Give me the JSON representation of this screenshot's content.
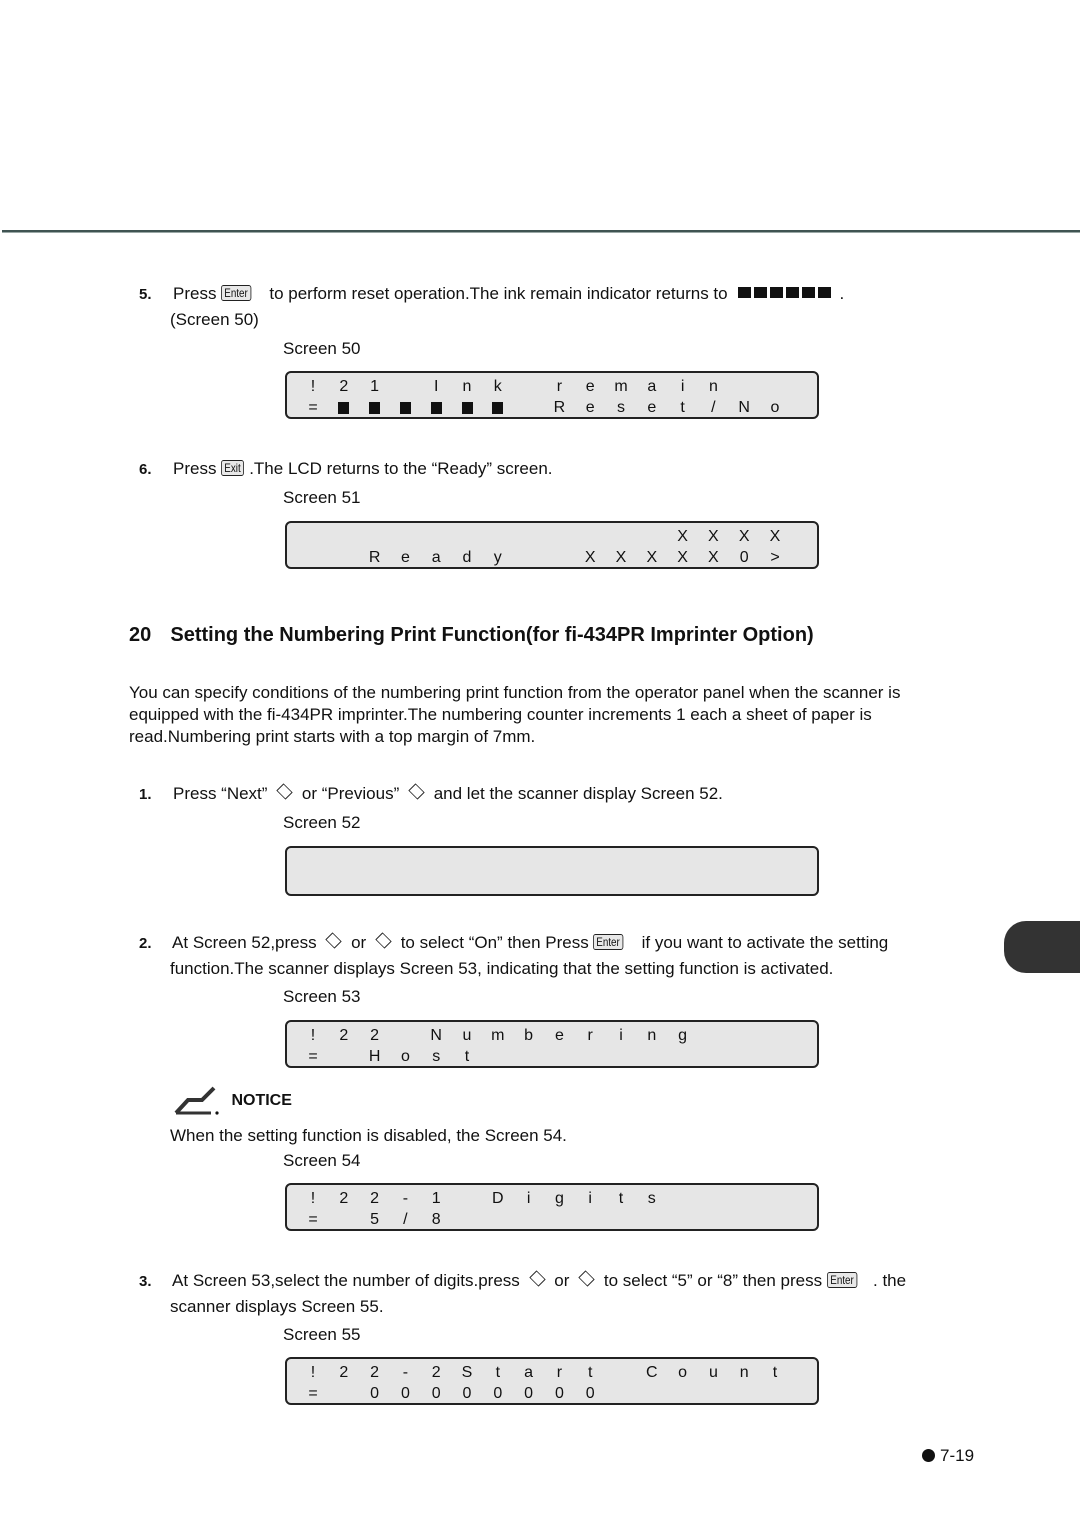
{
  "page": {
    "number": "7-19",
    "side_tab_color": "#333333"
  },
  "steps_top": [
    {
      "num": "5.",
      "pre": "Press",
      "key": "Enter",
      "post": "to perform reset operation.The ink remain indicator returns to",
      "indicator_blocks": 6,
      "tail": ".",
      "line2": "(Screen 50)",
      "screen_caption": "Screen 50",
      "lcd": {
        "row1": [
          "!",
          "2",
          "1",
          "",
          "I",
          "n",
          "k",
          "",
          "r",
          "e",
          "m",
          "a",
          "i",
          "n",
          "",
          ""
        ],
        "row2": [
          "=",
          "■",
          "■",
          "■",
          "■",
          "■",
          "■",
          "",
          "R",
          "e",
          "s",
          "e",
          "t",
          "/",
          "N",
          "o"
        ]
      }
    },
    {
      "num": "6.",
      "pre": "Press",
      "key": "Exit",
      "post": ".The LCD returns to the “Ready” screen.",
      "screen_caption": "Screen 51",
      "lcd": {
        "row1": [
          "",
          "",
          "",
          "",
          "",
          "",
          "",
          "",
          "",
          "",
          "",
          "",
          "X",
          "X",
          "X",
          "X"
        ],
        "row2": [
          "",
          "",
          "R",
          "e",
          "a",
          "d",
          "y",
          "",
          "",
          "X",
          "X",
          "X",
          "X",
          "X",
          "0",
          ">"
        ]
      }
    }
  ],
  "section": {
    "number": "20",
    "title": "Setting the Numbering Print Function(for fi-434PR Imprinter Option)",
    "intro": "You can specify conditions of the numbering print function from the operator panel when the scanner is equipped with the fi-434PR imprinter.The numbering counter increments 1 each a sheet of paper is read.Numbering print starts with a top margin of 7mm."
  },
  "steps": [
    {
      "num": "1.",
      "t1": "Press “Next”",
      "t2": "or “Previous”",
      "t3": "and let the scanner display Screen 52.",
      "screen_caption": "Screen 52",
      "lcd": {
        "row1": [
          "",
          "",
          "",
          "",
          "",
          "",
          "",
          "",
          "",
          "",
          "",
          "",
          "",
          "",
          "",
          ""
        ],
        "row2": [
          "",
          "",
          "",
          "",
          "",
          "",
          "",
          "",
          "",
          "",
          "",
          "",
          "",
          "",
          "",
          ""
        ]
      }
    },
    {
      "num": "2.",
      "t1": "At Screen 52,press",
      "t2": "or",
      "t3": "to select “On” then Press",
      "key": "Enter",
      "t4": "if you want to activate the setting",
      "line2": "function.The scanner displays Screen 53, indicating that the setting function is activated.",
      "screen_caption": "Screen 53",
      "lcd": {
        "row1": [
          "!",
          "2",
          "2",
          "",
          "N",
          "u",
          "m",
          "b",
          "e",
          "r",
          "i",
          "n",
          "g",
          "",
          "",
          ""
        ],
        "row2": [
          "=",
          "",
          "H",
          "o",
          "s",
          "t",
          "",
          "",
          "",
          "",
          "",
          "",
          "",
          "",
          "",
          ""
        ]
      }
    },
    {
      "num": "3.",
      "t1": "At Screen 53,select the number of digits.press",
      "t2": "or",
      "t3": "to select “5” or “8” then press",
      "key": "Enter",
      "t4": ". the",
      "line2": "scanner displays Screen 55.",
      "screen_caption": "Screen 55",
      "lcd": {
        "row1": [
          "!",
          "2",
          "2",
          "-",
          "2",
          "S",
          "t",
          "a",
          "r",
          "t",
          "",
          "C",
          "o",
          "u",
          "n",
          "t"
        ],
        "row2": [
          "=",
          "",
          "0",
          "0",
          "0",
          "0",
          "0",
          "0",
          "0",
          "0",
          "",
          "",
          "",
          "",
          "",
          ""
        ]
      }
    }
  ],
  "notice": {
    "label": "NOTICE",
    "text": "When the setting function is disabled, the Screen 54.",
    "screen_caption": "Screen 54",
    "lcd": {
      "row1": [
        "!",
        "2",
        "2",
        "-",
        "1",
        "",
        "D",
        "i",
        "g",
        "i",
        "t",
        "s",
        "",
        "",
        "",
        ""
      ],
      "row2": [
        "=",
        "",
        "5",
        "/",
        "8",
        "",
        "",
        "",
        "",
        "",
        "",
        "",
        "",
        "",
        "",
        ""
      ]
    }
  }
}
